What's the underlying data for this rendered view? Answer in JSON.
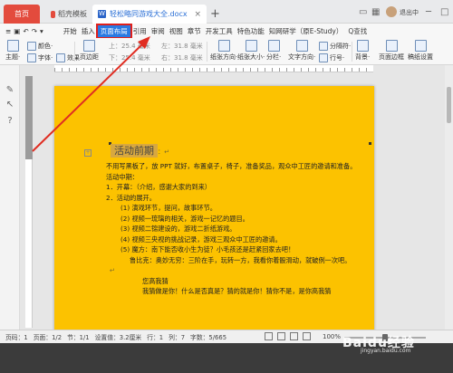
{
  "tabs": {
    "home": "首页",
    "template": "稻壳模板",
    "doc": "轻松略同游戏大全.docx",
    "close": "×",
    "new": "+"
  },
  "user": {
    "name": "退出中"
  },
  "menubar": {
    "items": [
      "开始",
      "插入",
      "页面布局",
      "引用",
      "审阅",
      "视图",
      "章节",
      "开发工具",
      "特色功能",
      "知网研学（原E-Study）"
    ],
    "active_index": 2,
    "search": "Q查找"
  },
  "ribbon": {
    "theme": "主题·",
    "colors": "颜色·",
    "fonts": "字体·",
    "effects": "效果·",
    "margins": "页边距",
    "top_margin": "上：25.4 毫米",
    "bottom_margin": "下：25.4 毫米",
    "left_margin": "左：31.8 毫米",
    "right_margin": "右：31.8 毫米",
    "orientation": "纸张方向·",
    "size": "纸张大小·",
    "columns": "分栏·",
    "text_direction": "文字方向·",
    "line_numbers": "行号·",
    "separator": "分隔符·",
    "background": "背景·",
    "page_border": "页面边框",
    "draft": "稿纸设置"
  },
  "document": {
    "heading": "活动前期",
    "lines": [
      "不用写黑板了，放 PPT 就好，布置桌子，椅子，准备奖品，观众中工匠的邀请和准备。",
      "活动中期：",
      "1．开幕：（介绍，感谢大家的到来）",
      "2．活动的展开。",
      "(1) 演戏环节，提问，故事环节。",
      "(2) 视频一琉璃的相关，游戏一记忆的题目。",
      "(3) 视频二锦建设的，游戏二折纸游戏。",
      "(4) 视频三央视的挑战记录，游戏三观众中工匠的邀请。",
      "(5) 魔方：南下能否收小生为徒？小毛孩还是赶紧回家去吧！",
      "鲁比克：奥妙无穷：三阶在手，玩转一方，我看你着骰滑动，就破例一次吧。",
      "您高我猜",
      "我猜做是你！什么是否真是？猜的就是你！猜你不是，是你高我猜"
    ]
  },
  "status": {
    "page": "页码：1",
    "pages": "页面：1/2",
    "section": "节：1/1",
    "position": "设置值：3.2厘米",
    "row": "行：1",
    "column": "列：7",
    "words": "字数：5/665",
    "zoom": "100%"
  },
  "watermark": {
    "text": "Baidu经验",
    "sub": "jingyan.baidu.com"
  },
  "colors": {
    "page": "#fcc200",
    "accent": "#2a7ae2",
    "highlight": "#e0201b"
  }
}
